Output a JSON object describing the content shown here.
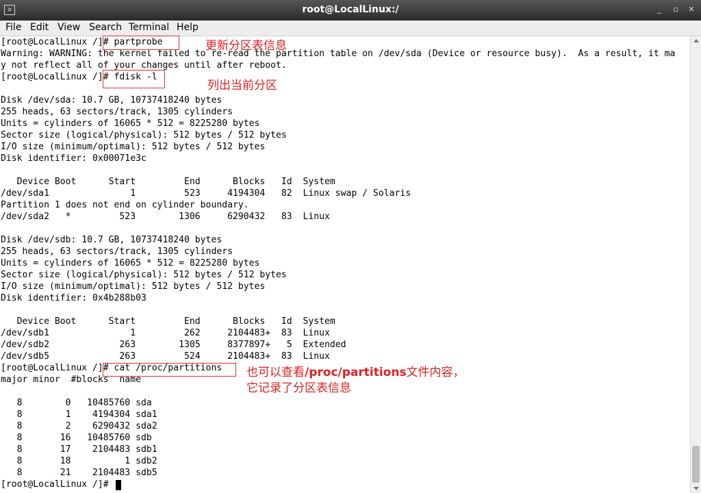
{
  "window": {
    "title": "root@LocalLinux:/",
    "icon_glyph": "≥",
    "minimize": "_",
    "maximize": "▫",
    "close": "✕"
  },
  "menu": [
    "File",
    "Edit",
    "View",
    "Search",
    "Terminal",
    "Help"
  ],
  "terminal_lines": [
    "[root@LocalLinux /]# partprobe",
    "Warning: WARNING: the kernel failed to re-read the partition table on /dev/sda (Device or resource busy).  As a result, it ma",
    "y not reflect all of your changes until after reboot.",
    "[root@LocalLinux /]# fdisk -l",
    "",
    "Disk /dev/sda: 10.7 GB, 10737418240 bytes",
    "255 heads, 63 sectors/track, 1305 cylinders",
    "Units = cylinders of 16065 * 512 = 8225280 bytes",
    "Sector size (logical/physical): 512 bytes / 512 bytes",
    "I/O size (minimum/optimal): 512 bytes / 512 bytes",
    "Disk identifier: 0x00071e3c",
    "",
    "   Device Boot      Start         End      Blocks   Id  System",
    "/dev/sda1               1         523     4194304   82  Linux swap / Solaris",
    "Partition 1 does not end on cylinder boundary.",
    "/dev/sda2   *         523        1306     6290432   83  Linux",
    "",
    "Disk /dev/sdb: 10.7 GB, 10737418240 bytes",
    "255 heads, 63 sectors/track, 1305 cylinders",
    "Units = cylinders of 16065 * 512 = 8225280 bytes",
    "Sector size (logical/physical): 512 bytes / 512 bytes",
    "I/O size (minimum/optimal): 512 bytes / 512 bytes",
    "Disk identifier: 0x4b288b03",
    "",
    "   Device Boot      Start         End      Blocks   Id  System",
    "/dev/sdb1               1         262     2104483+  83  Linux",
    "/dev/sdb2             263        1305     8377897+   5  Extended",
    "/dev/sdb5             263         524     2104483+  83  Linux",
    "[root@LocalLinux /]# cat /proc/partitions",
    "major minor  #blocks  name",
    "",
    "   8        0   10485760 sda",
    "   8        1    4194304 sda1",
    "   8        2    6290432 sda2",
    "   8       16   10485760 sdb",
    "   8       17    2104483 sdb1",
    "   8       18          1 sdb2",
    "   8       21    2104483 sdb5",
    "[root@LocalLinux /]# "
  ],
  "annotations": {
    "partprobe_note": "更新分区表信息",
    "fdisk_note": "列出当前分区",
    "proc_note_prefix": "也可以查看",
    "proc_note_path": "/proc/partitions",
    "proc_note_suffix": "文件内容，",
    "proc_note_line2": "它记录了分区表信息"
  },
  "colors": {
    "annotation": "#e02020",
    "titlebar": "#3a3a3a",
    "menubar": "#ededed"
  }
}
